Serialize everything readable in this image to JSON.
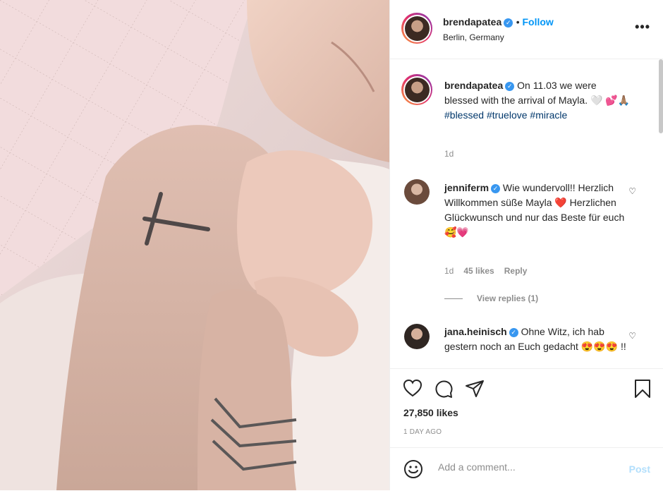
{
  "header": {
    "username": "brendapatea",
    "follow_label": "Follow",
    "location": "Berlin, Germany",
    "more_label": "•••"
  },
  "caption": {
    "username": "brendapatea",
    "text": "On 11.03 we were blessed with the arrival of Mayla.",
    "emoji_line": "🤍 💕🙏🏽",
    "hashtags": [
      "#blessed",
      "#truelove",
      "#miracle"
    ],
    "time": "1d"
  },
  "comments": [
    {
      "username": "jenniferm",
      "text": "Wie wundervoll!! Herzlich Willkommen süße Mayla ❤️ Herzlichen Glückwunsch und nur das Beste für euch 🥰💗",
      "time": "1d",
      "likes": "45 likes",
      "reply": "Reply",
      "view_replies": "View replies (1)"
    },
    {
      "username": "jana.heinisch",
      "text": "Ohne Witz, ich hab gestern noch an Euch gedacht 😍😍😍 !!"
    }
  ],
  "actions": {
    "likes": "27,850 likes",
    "time_ago": "1 DAY AGO"
  },
  "add_comment": {
    "placeholder": "Add a comment...",
    "post_label": "Post"
  },
  "colors": {
    "accent": "#0095f6",
    "verified": "#3897f0",
    "hashtag": "#00376b",
    "post_disabled": "#b2dffc"
  }
}
